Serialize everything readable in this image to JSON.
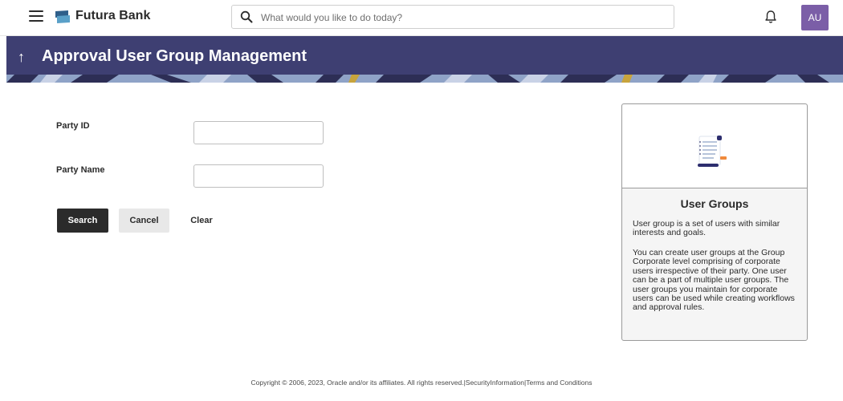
{
  "header": {
    "bank_name": "Futura Bank",
    "search_placeholder": "What would you like to do today?",
    "avatar_initials": "AU"
  },
  "page": {
    "title": "Approval User Group Management"
  },
  "form": {
    "party_id_label": "Party ID",
    "party_id_value": "",
    "party_name_label": "Party Name",
    "party_name_value": "",
    "search_label": "Search",
    "cancel_label": "Cancel",
    "clear_label": "Clear"
  },
  "info_card": {
    "title": "User Groups",
    "paragraph1": "User group is a set of users with similar interests and goals.",
    "paragraph2": "You can create user groups at the Group Corporate level comprising of corporate users irrespective of their party. One user can be a part of multiple user groups. The user groups you maintain for corporate users can be used while creating workflows and approval rules."
  },
  "footer": {
    "copyright": "Copyright © 2006, 2023, Oracle and/or its affiliates. All rights reserved.",
    "security_link": "|SecurityInformation|",
    "terms_link": "Terms and Conditions"
  },
  "colors": {
    "title_band": "#3e3f72",
    "avatar": "#7b5ea7",
    "primary_button": "#2b2b2b"
  }
}
